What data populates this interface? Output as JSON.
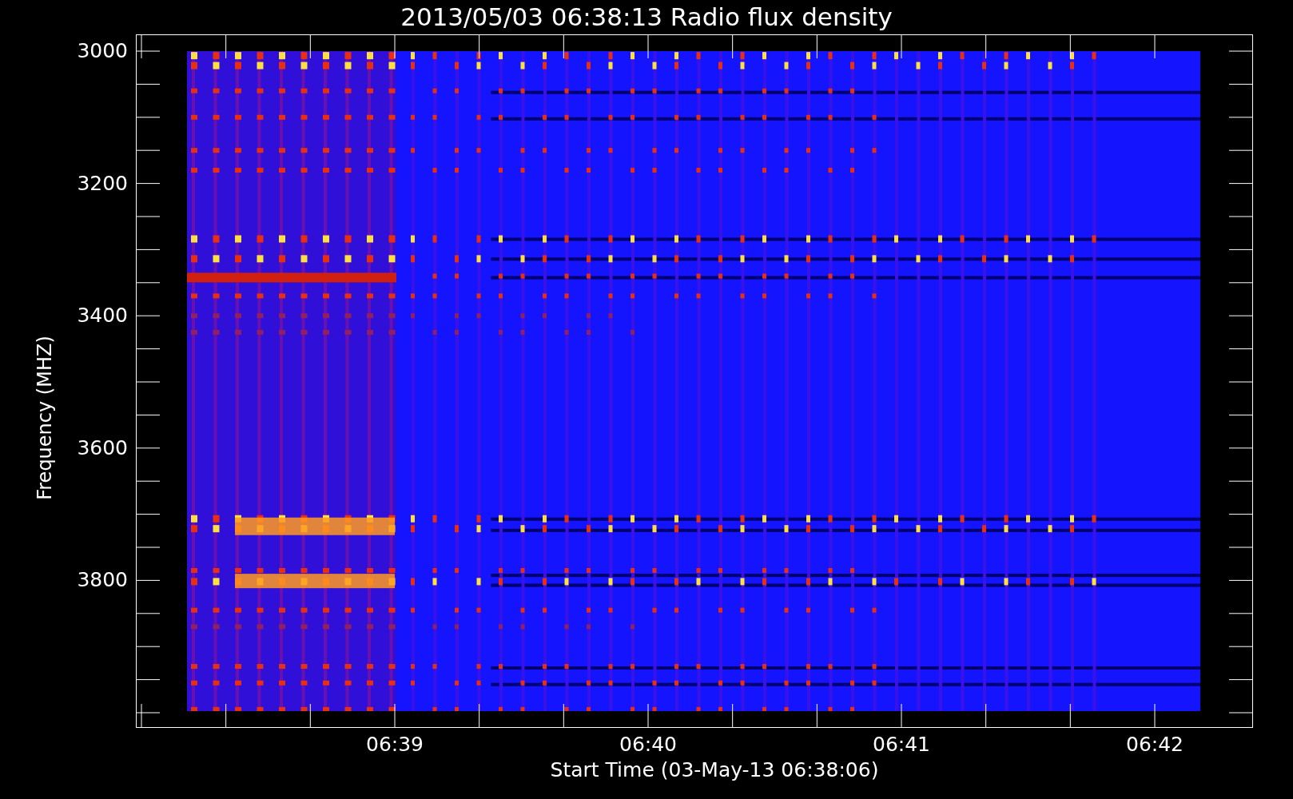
{
  "title": "2013/05/03 06:38:13 Radio flux density",
  "y_axis": {
    "label": "Frequency (MHZ)",
    "ticks": [
      "3000",
      "3200",
      "3400",
      "3600",
      "3800"
    ]
  },
  "x_axis": {
    "label": "Start Time (03-May-13 06:38:06)",
    "ticks": [
      "06:39",
      "06:40",
      "06:41",
      "06:42"
    ]
  }
}
